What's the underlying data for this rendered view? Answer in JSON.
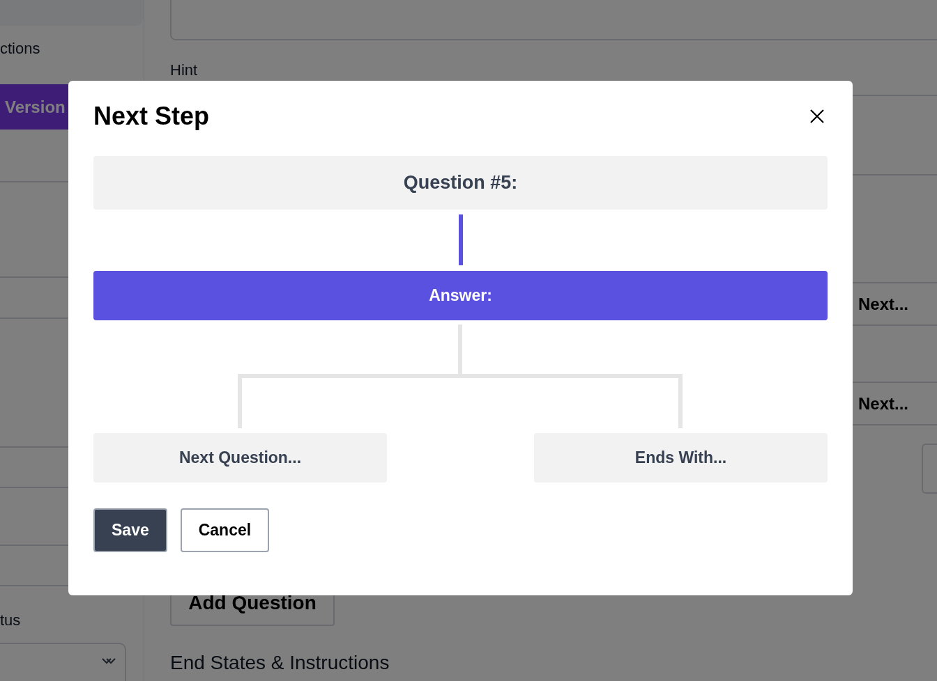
{
  "background": {
    "sidebar": {
      "section_label": "ctions",
      "version_button": "Version",
      "status_label": "tus"
    },
    "main": {
      "hint_label": "Hint",
      "next_rows": [
        "Next...",
        "Next..."
      ],
      "add_question_button": "Add Question",
      "end_states_heading": "End States & Instructions"
    }
  },
  "dialog": {
    "title": "Next Step",
    "question": "Question #5:",
    "answer": "Answer:",
    "branches": [
      "Next Question...",
      "Ends With..."
    ],
    "buttons": [
      {
        "label": "Save",
        "kind": "primary"
      },
      {
        "label": "Cancel",
        "kind": "secondary"
      }
    ]
  }
}
